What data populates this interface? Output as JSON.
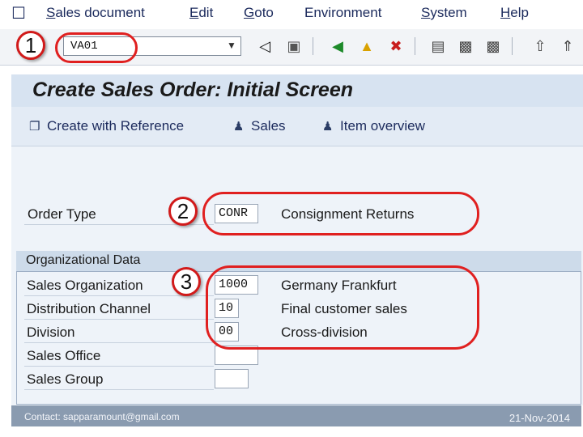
{
  "menu": {
    "items": [
      {
        "first": "S",
        "rest": "ales document"
      },
      {
        "first": "E",
        "rest": "dit"
      },
      {
        "first": "G",
        "rest": "oto"
      },
      {
        "first": "En",
        "rest": "vironment"
      },
      {
        "first": "S",
        "rest": "ystem"
      },
      {
        "first": "H",
        "rest": "elp"
      }
    ]
  },
  "toolbar": {
    "command_value": "VA01"
  },
  "screen": {
    "title": "Create Sales Order: Initial Screen",
    "app_buttons": [
      "Create with Reference",
      "Sales",
      "Item overview"
    ]
  },
  "order_type": {
    "label": "Order Type",
    "value": "CONR",
    "description": "Consignment Returns"
  },
  "org_data": {
    "title": "Organizational Data",
    "rows": [
      {
        "label": "Sales Organization",
        "value": "1000",
        "description": "Germany Frankfurt"
      },
      {
        "label": "Distribution Channel",
        "value": "10",
        "description": "Final customer sales"
      },
      {
        "label": "Division",
        "value": "00",
        "description": "Cross-division"
      },
      {
        "label": "Sales Office",
        "value": "",
        "description": ""
      },
      {
        "label": "Sales Group",
        "value": "",
        "description": ""
      }
    ]
  },
  "annotations": [
    "1",
    "2",
    "3"
  ],
  "footer": {
    "contact": "Contact: sapparamount@gmail.com",
    "date": "21-Nov-2014"
  },
  "colors": {
    "annotation_red": "#e02020",
    "title_bg": "#d7e3f1",
    "footer_bg": "#8a9bb0"
  }
}
